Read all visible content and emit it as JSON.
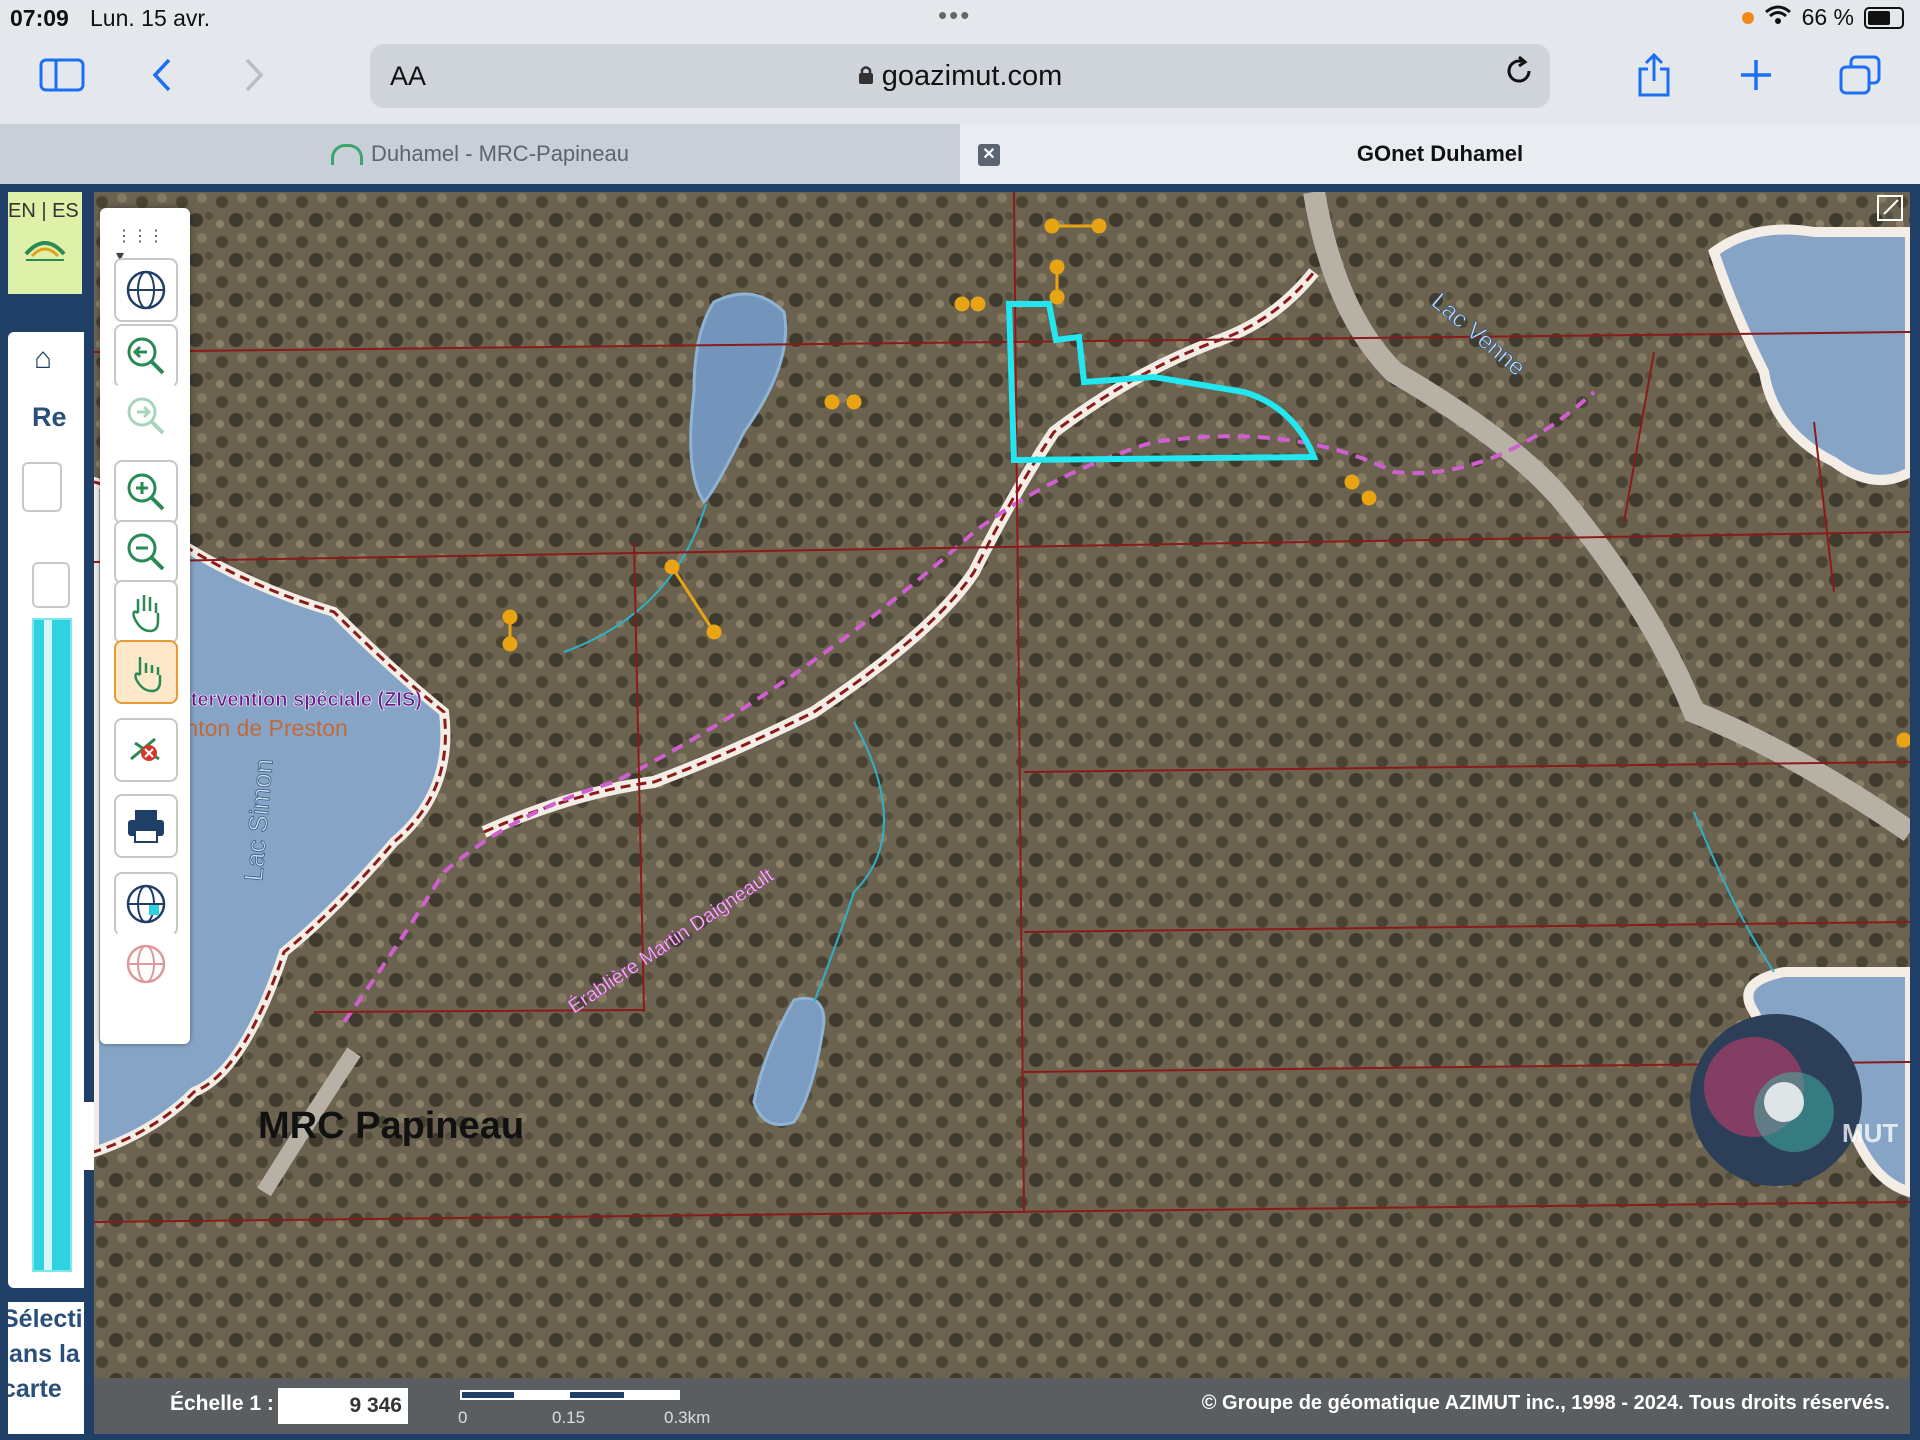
{
  "status": {
    "time": "07:09",
    "date": "Lun. 15 avr.",
    "battery": "66 %"
  },
  "browser": {
    "url": "goazimut.com",
    "aa": "AA"
  },
  "tabs": [
    {
      "label": "Duhamel - MRC-Papineau"
    },
    {
      "label": "GOnet Duhamel"
    }
  ],
  "sidebar": {
    "lang": "EN | ES",
    "re": "Re",
    "select_lines": [
      "Sélecti",
      "lans la",
      "carte"
    ]
  },
  "map": {
    "labels": {
      "lac_venne": "Lac Venne",
      "lac_simon": "Lac Simon",
      "zis": "d'intervention spéciale (ZIS)",
      "canton": "Canton de Preston",
      "erabliere": "Érablière Martin Daigneault",
      "mrc": "MRC Papineau",
      "azimut": "MUT"
    },
    "colors": {
      "forest": "#6d6450",
      "water": "#86a5c6",
      "parcel_line": "#8b1b1b",
      "selection": "#22e6f0",
      "zis": "#6a1a8c",
      "canton": "#c06a3a",
      "erabliere": "#d05fd0",
      "marker": "#e9a414"
    }
  },
  "scale": {
    "label": "Échelle 1 :",
    "value": "9 346",
    "ticks": [
      "0",
      "0.15",
      "0.3km"
    ]
  },
  "copyright": "© Groupe de géomatique AZIMUT inc., 1998 - 2024. Tous droits réservés."
}
